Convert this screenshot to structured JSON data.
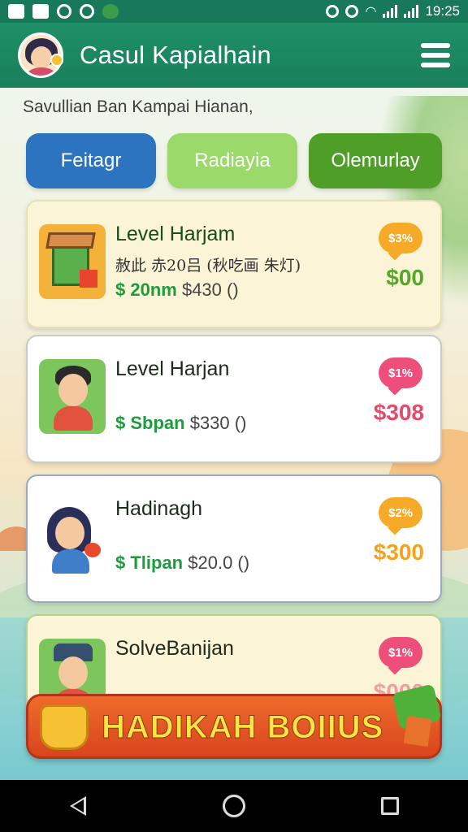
{
  "status_bar": {
    "time": "19:25",
    "left_icons": [
      "image-icon",
      "gamepad-icon",
      "sync-icon",
      "shield-icon",
      "leaf-icon"
    ],
    "right_icons": [
      "alarm-icon",
      "vpn-icon",
      "wifi-icon",
      "signal-icon",
      "signal-icon"
    ]
  },
  "app_bar": {
    "title": "Casul Kapialhain",
    "menu_icon": "hamburger-menu-icon"
  },
  "subtitle": "Savullian Ban Kampai Hianan,",
  "tabs": [
    {
      "label": "Feitagr",
      "color": "#2c74bf"
    },
    {
      "label": "Radiayia",
      "color": "#9ad96a"
    },
    {
      "label": "Olemurlay",
      "color": "#4f9e28"
    }
  ],
  "cards": [
    {
      "title": "Level Harjam",
      "description": "赦此 赤20吕 (秋吃画 朱灯)",
      "price_tag": "$ 20nm",
      "price_orig": "$430 ()",
      "badge": "$3%",
      "badge_color": "#f7a928",
      "amount": "$00",
      "icon": "crate-icon"
    },
    {
      "title": "Level Harjan",
      "description": "",
      "price_tag": "$ Sbpan",
      "price_orig": "$330 ()",
      "badge": "$1%",
      "badge_color": "#ee4f7a",
      "amount": "$308",
      "icon": "boy-avatar-icon"
    },
    {
      "title": "Hadinagh",
      "description": "",
      "price_tag": "$ Tlipan",
      "price_orig": "$20.0 ()",
      "badge": "$2%",
      "badge_color": "#f7a928",
      "amount": "$300",
      "icon": "girl-avatar-icon"
    },
    {
      "title": "SolveBanijan",
      "description": "",
      "price_tag": "",
      "price_orig": "",
      "badge": "$1%",
      "badge_color": "#ee4f7a",
      "amount": "$000",
      "icon": "cap-boy-avatar-icon"
    }
  ],
  "bonus_banner": {
    "label": "HADIKAH BOIIUS"
  },
  "nav_bar": {
    "icons": [
      "back-icon",
      "home-icon",
      "recents-icon"
    ]
  }
}
